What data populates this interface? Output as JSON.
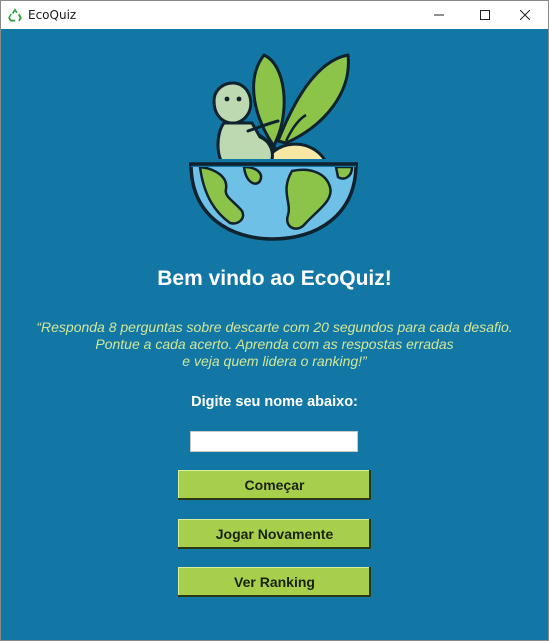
{
  "window": {
    "title": "EcoQuiz",
    "icon": "recycle-icon",
    "controls": [
      "minimize-icon",
      "maximize-icon",
      "close-icon"
    ]
  },
  "main": {
    "welcome": "Bem vindo ao EcoQuiz!",
    "intro_lines": [
      "“Responda 8 perguntas sobre descarte com 20 segundos para cada desafio.",
      "Pontue a cada acerto. Aprenda com as respostas erradas",
      "e veja quem lidera o ranking!”"
    ],
    "name_label": "Digite seu nome abaixo:",
    "name_value": "",
    "buttons": {
      "start": "Começar",
      "play_again": "Jogar Novamente",
      "ranking": "Ver Ranking"
    }
  },
  "colors": {
    "background": "#1277a5",
    "button": "#a7cf4c",
    "intro_text": "#d2e69a",
    "recycle": "#2e9e3a"
  }
}
